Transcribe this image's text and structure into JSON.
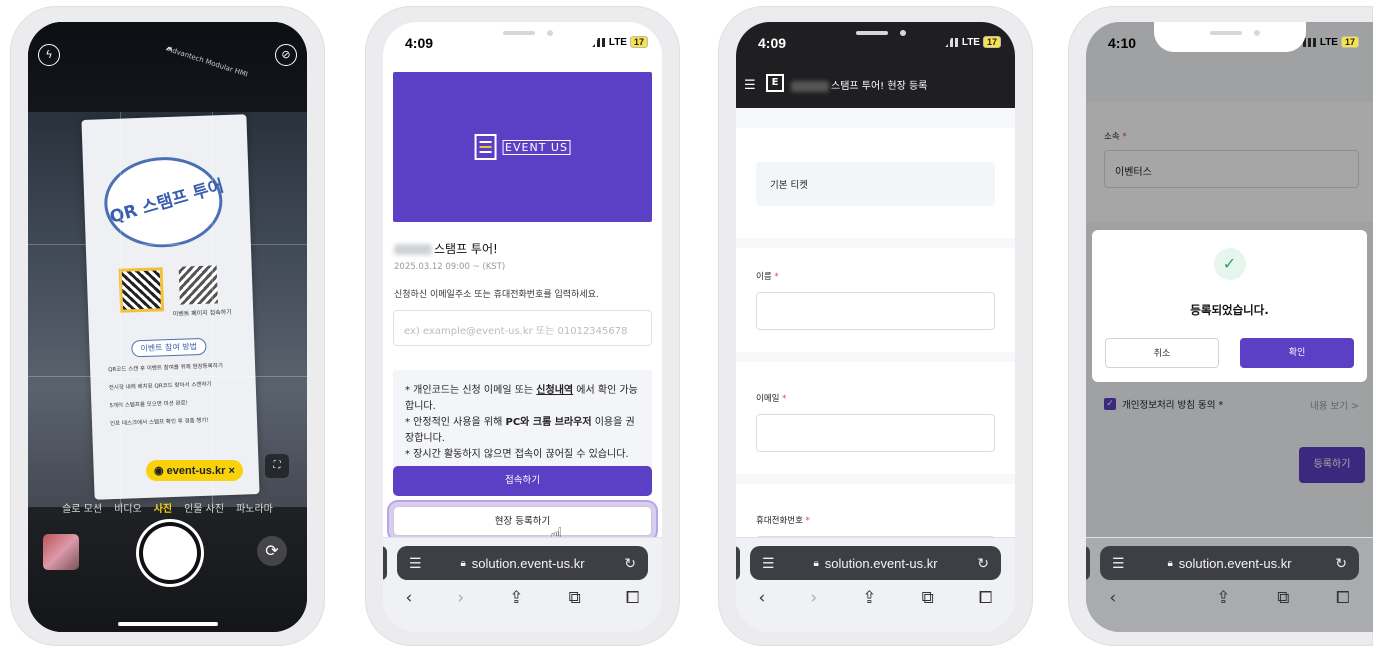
{
  "camera": {
    "banner_title": "QR 스탬프 투어",
    "qr_caption": "이벤트 페이지 접속하기",
    "how_to_pill": "이벤트 참여 방법",
    "steps": [
      "QR코드 스캔 후 이벤트 참여를 위해 현장등록하기",
      "전시장 내에 배치된 QR코드 찾아서 스캔하기",
      "5개의 스탬프를 모으면 미션 완료!",
      "인포 데스크에서 스탬프 확인 후 경품 챙기!"
    ],
    "link_pill": "event-us.kr",
    "link_close": "×",
    "top_label": "Advantech Modular HMI",
    "modes": [
      "슬로 모션",
      "비디오",
      "사진",
      "인물 사진",
      "파노라마"
    ],
    "active_mode": "사진",
    "icons": [
      "flash-icon",
      "chevron-up-icon",
      "live-off-icon",
      "qr-scan-icon",
      "rotate-camera-icon"
    ]
  },
  "screen2": {
    "time": "4:09",
    "signal": "LTE",
    "battery": "17",
    "logo_text": "EVENT US",
    "event_title_suffix": "스탬프 투어!",
    "event_date": "2025.03.12 09:00 ~ (KST)",
    "instruction": "신청하신 이메일주소 또는 휴대전화번호를 입력하세요.",
    "input_placeholder": "ex) example@event-us.kr 또는 01012345678",
    "notice_1a": "* 개인코드는 신청 이메일 또는 ",
    "notice_1b": "신청내역",
    "notice_1c": " 에서 확인 가능합니다.",
    "notice_2a": "* 안정적인 사용을 위해 ",
    "notice_2b": "PC와 크롬 브라우저",
    "notice_2c": " 이용을 권장합니다.",
    "notice_3": "* 장시간 활동하지 않으면 접속이 끊어질 수 있습니다.",
    "connect_button": "접속하기",
    "register_button": "현장 등록하기"
  },
  "screen3": {
    "time": "4:09",
    "signal": "LTE",
    "battery": "17",
    "nav_title": "스탬프 투어! 현장 등록",
    "ticket": "기본 티켓",
    "name_label": "이름",
    "email_label": "이메일",
    "phone_label": "휴대전화번호",
    "required_mark": "*"
  },
  "screen4": {
    "time": "4:10",
    "signal": "LTE",
    "battery": "17",
    "affiliation_label": "소속",
    "affiliation_value": "이벤터스",
    "modal_message": "등록되었습니다.",
    "cancel_button": "취소",
    "confirm_button": "확인",
    "privacy_label": "개인정보처리 방침 동의 *",
    "view_link": "내용 보기 >",
    "register_button": "등록하기"
  },
  "safari": {
    "url": "solution.event-us.kr"
  }
}
